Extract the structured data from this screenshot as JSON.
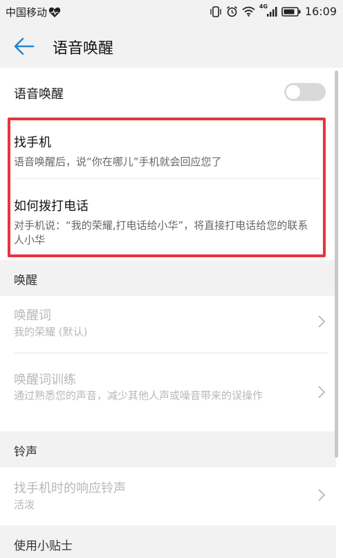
{
  "status_bar": {
    "carrier": "中国移动",
    "network": "4G",
    "time": "16:09",
    "icons": [
      "heart-icon",
      "vibrate-icon",
      "alarm-icon",
      "wifi-icon",
      "signal-icon",
      "battery-icon"
    ]
  },
  "header": {
    "title": "语音唤醒",
    "back_icon": "arrow-left-icon",
    "accent": "#1f87d6"
  },
  "voice_wakeup": {
    "label": "语音唤醒",
    "enabled": false
  },
  "tips": [
    {
      "title": "找手机",
      "desc": "语音唤醒后，说“你在哪儿”手机就会回应您了"
    },
    {
      "title": "如何拨打电话",
      "desc": "对手机说：“我的荣耀,打电话给小华”，将直接打电话给您的联系人小华"
    }
  ],
  "highlight_color": "#e8333b",
  "sections": {
    "wakeup": {
      "header": "唤醒",
      "items": [
        {
          "title": "唤醒词",
          "subtitle": "我的荣耀 (默认)"
        },
        {
          "title": "唤醒词训练",
          "subtitle": "通过熟悉您的声音，减少其他人声或噪音带来的误操作"
        }
      ]
    },
    "ringtone": {
      "header": "铃声",
      "items": [
        {
          "title": "找手机时的响应铃声",
          "subtitle": "活泼"
        }
      ]
    },
    "tips": {
      "header": "使用小贴士"
    }
  }
}
